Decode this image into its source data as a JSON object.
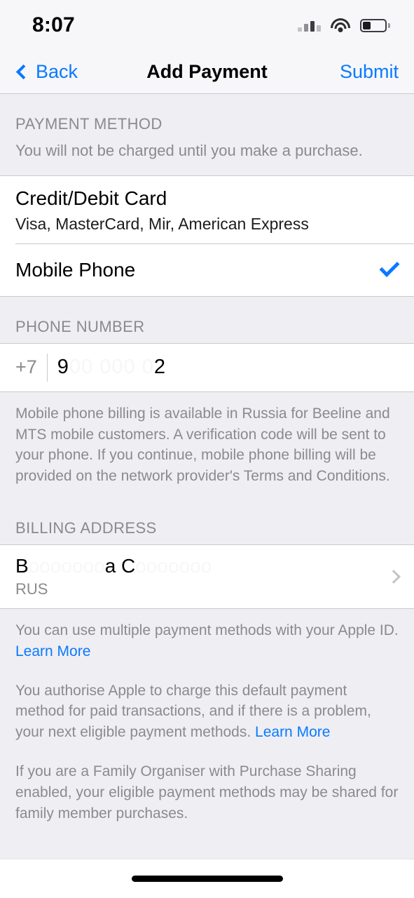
{
  "status_bar": {
    "time": "8:07",
    "signal_icon": "cellular-signal-icon",
    "wifi_icon": "wifi-icon",
    "battery_icon": "battery-icon",
    "battery_level_percent": 35
  },
  "nav_bar": {
    "back_label": "Back",
    "title": "Add Payment",
    "submit_label": "Submit",
    "accent_color": "#0A7AFF"
  },
  "payment_method": {
    "header": "PAYMENT METHOD",
    "subtitle": "You will not be charged until you make a purchase.",
    "options": [
      {
        "title": "Credit/Debit Card",
        "subtitle": "Visa, MasterCard, Mir, American Express",
        "selected": false
      },
      {
        "title": "Mobile Phone",
        "subtitle": "",
        "selected": true
      }
    ]
  },
  "phone_number": {
    "header": "PHONE NUMBER",
    "country_code": "+7",
    "value_visible_prefix": "9",
    "value_redacted_middle": "00 000 0",
    "value_visible_suffix": "2",
    "footer": "Mobile phone billing is available in Russia for Beeline and MTS mobile customers. A verification code will be sent to your phone. If you continue, mobile phone billing will be provided on the network provider's Terms and Conditions."
  },
  "billing_address": {
    "header": "BILLING ADDRESS",
    "line1_part1": "B",
    "line1_redacted1": "ooooooo",
    "line1_part2": "a C",
    "line1_redacted2": "ooooooo",
    "country": "RUS",
    "disclosure_icon": "chevron-right-icon"
  },
  "footer": {
    "paragraph1_before": "You can use multiple payment methods with your Apple ID. ",
    "paragraph1_link": "Learn More",
    "paragraph2_before": "You authorise Apple to charge this default payment method for paid transactions, and if there is a problem, your next eligible payment methods. ",
    "paragraph2_link": "Learn More",
    "paragraph3": "If you are a Family Organiser with Purchase Sharing enabled, your eligible payment methods may be shared for family member purchases."
  },
  "home_indicator": "home-indicator"
}
